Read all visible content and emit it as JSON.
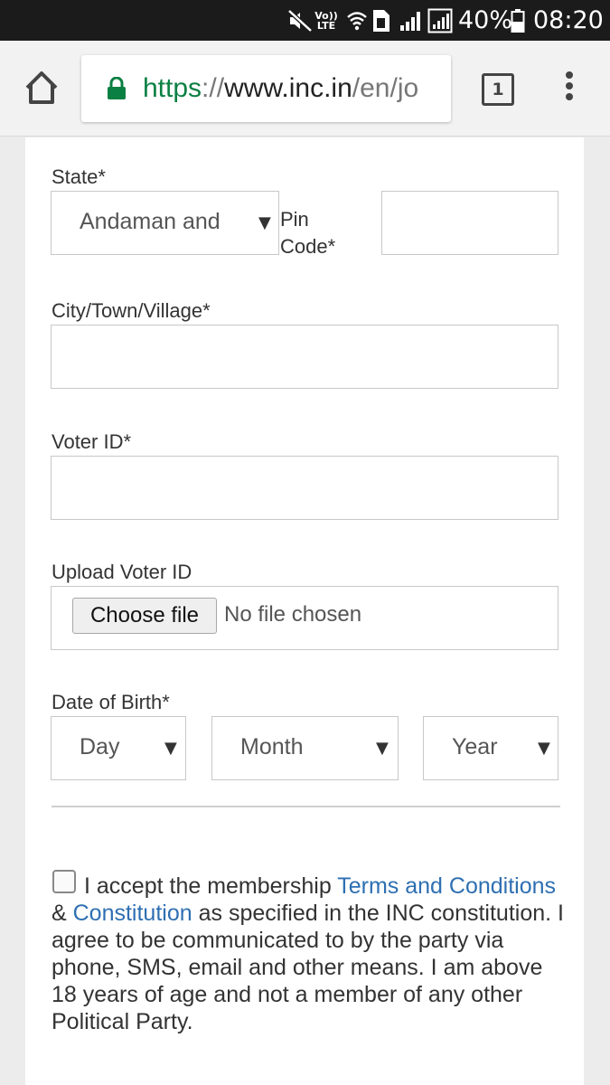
{
  "status_bar": {
    "volte_label": "Vo)) LTE",
    "battery_percent": "40%",
    "time": "08:20"
  },
  "browser": {
    "url_scheme": "https",
    "url_separator": "://",
    "url_host": "www.inc.in",
    "url_path": "/en/jo",
    "tab_count": "1"
  },
  "form": {
    "state": {
      "label": "State*",
      "selected": "Andaman and"
    },
    "pin_code": {
      "label_line1": "Pin",
      "label_line2": "Code*",
      "value": ""
    },
    "city": {
      "label": "City/Town/Village*",
      "value": ""
    },
    "voter_id": {
      "label": "Voter ID*",
      "value": ""
    },
    "upload": {
      "label": "Upload Voter ID",
      "button": "Choose file",
      "status": "No file chosen"
    },
    "dob": {
      "label": "Date of Birth*",
      "day": "Day",
      "month": "Month",
      "year": "Year"
    },
    "terms": {
      "accepted": false,
      "part1": "I accept the membership ",
      "link1": "Terms and Conditions",
      "part2": " & ",
      "link2": "Constitution",
      "part3": " as specified in the INC constitution. I agree to be communicated to by the party via phone, SMS, email and other means. I am above 18 years of age and not a member of any other Political Party."
    }
  }
}
